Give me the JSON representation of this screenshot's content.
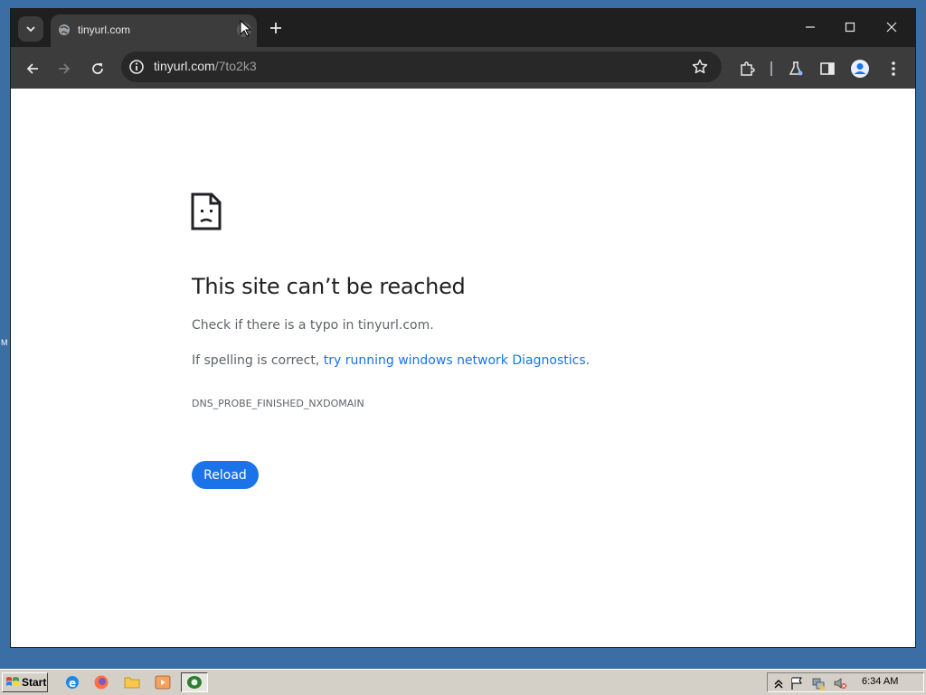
{
  "desktop": {
    "edge_label": "M"
  },
  "browser": {
    "tab": {
      "title": "tinyurl.com"
    },
    "address": {
      "host": "tinyurl.com",
      "path": "/7to2k3"
    }
  },
  "error_page": {
    "title": "This site can’t be reached",
    "line1": "Check if there is a typo in tinyurl.com.",
    "line2_prefix": "If spelling is correct, ",
    "line2_link": "try running windows network Diagnostics",
    "line2_suffix": ".",
    "error_code": "DNS_PROBE_FINISHED_NXDOMAIN",
    "reload_label": "Reload"
  },
  "taskbar": {
    "start_label": "Start",
    "clock": "6:34 AM",
    "quick_launch": [
      "ie-icon",
      "firefox-icon",
      "folder-icon",
      "media-player-icon"
    ]
  },
  "colors": {
    "accent": "#1a73e8",
    "toolbar": "#3c3c3c",
    "tabstrip": "#1f1f1f",
    "desktop": "#3a6ea5"
  }
}
